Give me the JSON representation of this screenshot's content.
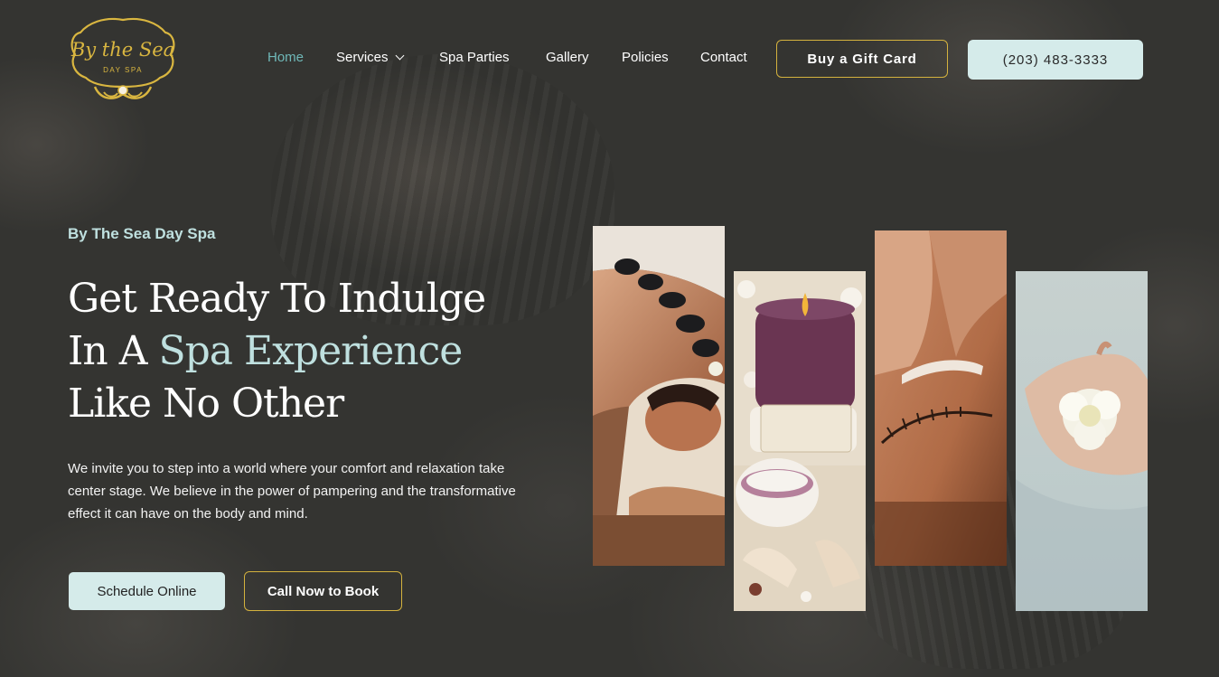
{
  "brand": {
    "logo_alt": "By the Sea Day Spa",
    "logo_script": "By the Sea",
    "logo_sub": "DAY SPA",
    "gold": "#d4b23e",
    "aqua": "#bfe0df",
    "active_nav": "#6fb8b8"
  },
  "nav": {
    "items": [
      {
        "label": "Home",
        "active": true
      },
      {
        "label": "Services",
        "has_dropdown": true
      },
      {
        "label": "Spa Parties"
      },
      {
        "label": "Gallery"
      },
      {
        "label": "Policies"
      },
      {
        "label": "Contact"
      }
    ],
    "gift_button": "Buy a Gift Card",
    "phone_button": "(203) 483-3333"
  },
  "hero": {
    "eyebrow": "By The Sea Day Spa",
    "headline_line1": "Get Ready To Indulge",
    "headline_line2_prefix": "In A ",
    "headline_line2_accent": "Spa Experience",
    "headline_line3": "Like No Other",
    "body": "We invite you to step into a world where your comfort and relaxation take center stage. We believe in the power of pampering and the transformative effect it can have on the body and mind.",
    "primary_button": "Schedule Online",
    "secondary_button": "Call Now to Book"
  },
  "gallery": [
    {
      "subject": "hot-stone-massage"
    },
    {
      "subject": "candle-and-spa-salts"
    },
    {
      "subject": "facial-massage"
    },
    {
      "subject": "flower-in-water"
    }
  ]
}
